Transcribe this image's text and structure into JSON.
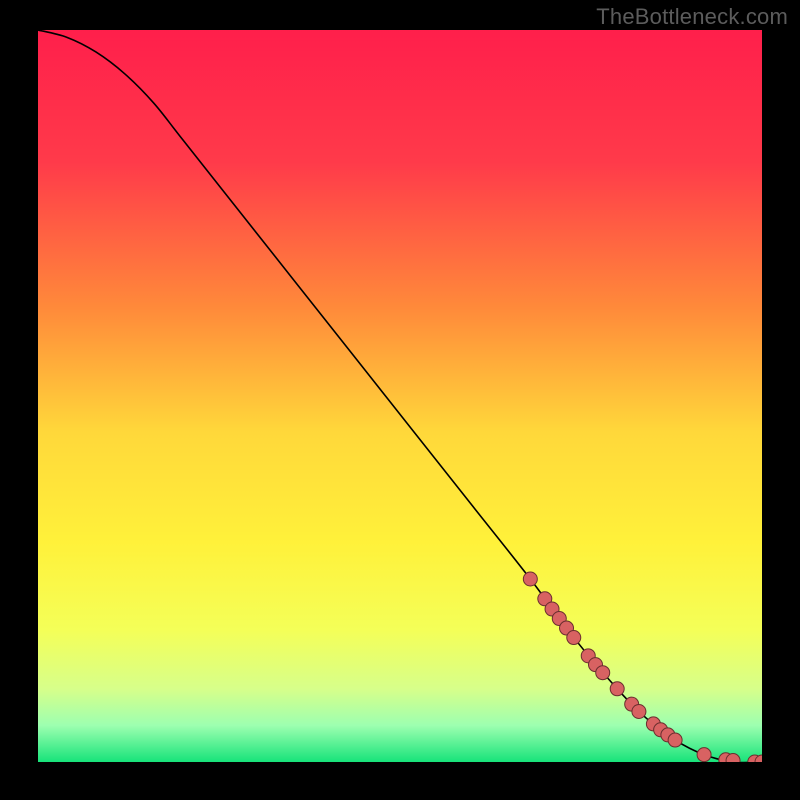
{
  "watermark": "TheBottleneck.com",
  "chart_data": {
    "type": "line",
    "title": "",
    "xlabel": "",
    "ylabel": "",
    "xlim": [
      0,
      100
    ],
    "ylim": [
      0,
      100
    ],
    "grid": false,
    "legend": false,
    "background_gradient": {
      "stops": [
        {
          "pct": 0,
          "color": "#ff1f4b"
        },
        {
          "pct": 18,
          "color": "#ff3a4a"
        },
        {
          "pct": 38,
          "color": "#ff8a3a"
        },
        {
          "pct": 55,
          "color": "#ffd83a"
        },
        {
          "pct": 70,
          "color": "#fff13a"
        },
        {
          "pct": 82,
          "color": "#f4ff58"
        },
        {
          "pct": 90,
          "color": "#d7ff8a"
        },
        {
          "pct": 95,
          "color": "#9dffb0"
        },
        {
          "pct": 100,
          "color": "#17e37a"
        }
      ]
    },
    "series": [
      {
        "name": "curve",
        "x": [
          0,
          4,
          8,
          12,
          16,
          20,
          28,
          36,
          44,
          52,
          60,
          68,
          74,
          80,
          84,
          88,
          92,
          96,
          100
        ],
        "y": [
          100,
          99,
          97,
          94,
          90,
          85,
          75,
          65,
          55,
          45,
          35,
          25,
          17,
          10,
          6,
          3,
          1,
          0,
          0
        ],
        "stroke": "#000000",
        "stroke_width": 1.6
      }
    ],
    "markers": [
      {
        "x": 68,
        "y": 25.0
      },
      {
        "x": 70,
        "y": 22.3
      },
      {
        "x": 71,
        "y": 20.9
      },
      {
        "x": 72,
        "y": 19.6
      },
      {
        "x": 73,
        "y": 18.3
      },
      {
        "x": 74,
        "y": 17.0
      },
      {
        "x": 76,
        "y": 14.5
      },
      {
        "x": 77,
        "y": 13.3
      },
      {
        "x": 78,
        "y": 12.2
      },
      {
        "x": 80,
        "y": 10.0
      },
      {
        "x": 82,
        "y": 7.9
      },
      {
        "x": 83,
        "y": 6.9
      },
      {
        "x": 85,
        "y": 5.2
      },
      {
        "x": 86,
        "y": 4.4
      },
      {
        "x": 87,
        "y": 3.7
      },
      {
        "x": 88,
        "y": 3.0
      },
      {
        "x": 92,
        "y": 1.0
      },
      {
        "x": 95,
        "y": 0.3
      },
      {
        "x": 96,
        "y": 0.2
      },
      {
        "x": 99,
        "y": 0.0
      },
      {
        "x": 100,
        "y": 0.0
      }
    ],
    "marker_style": {
      "fill": "#d86262",
      "stroke": "#6a2f2f",
      "r": 7
    }
  }
}
